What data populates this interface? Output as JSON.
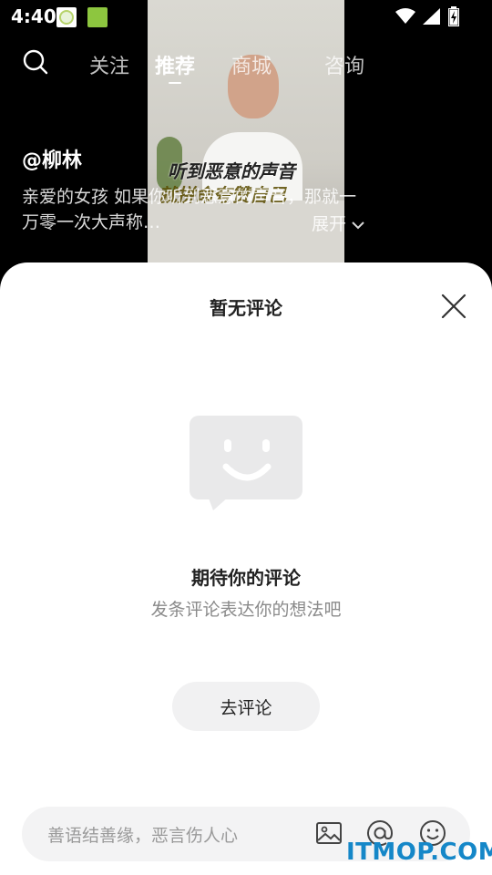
{
  "status": {
    "time": "4:40"
  },
  "video": {
    "caption_line1": "听到恶意的声音",
    "caption_line2": "就拼命夸赞自己"
  },
  "top_nav": {
    "tabs": [
      "关注",
      "推荐",
      "商城",
      "咨询"
    ],
    "active_tab": "推荐"
  },
  "post": {
    "author": "@柳林",
    "description": "亲爱的女孩 如果你听到恶意的声音，那就一万零一次大声称…",
    "expand_label": "展开"
  },
  "comments_sheet": {
    "title": "暂无评论",
    "empty_title": "期待你的评论",
    "empty_subtitle": "发条评论表达你的想法吧",
    "go_comment_label": "去评论",
    "input_placeholder": "善语结善缘，恶言伤人心"
  },
  "watermark": "ITMOP.COM"
}
